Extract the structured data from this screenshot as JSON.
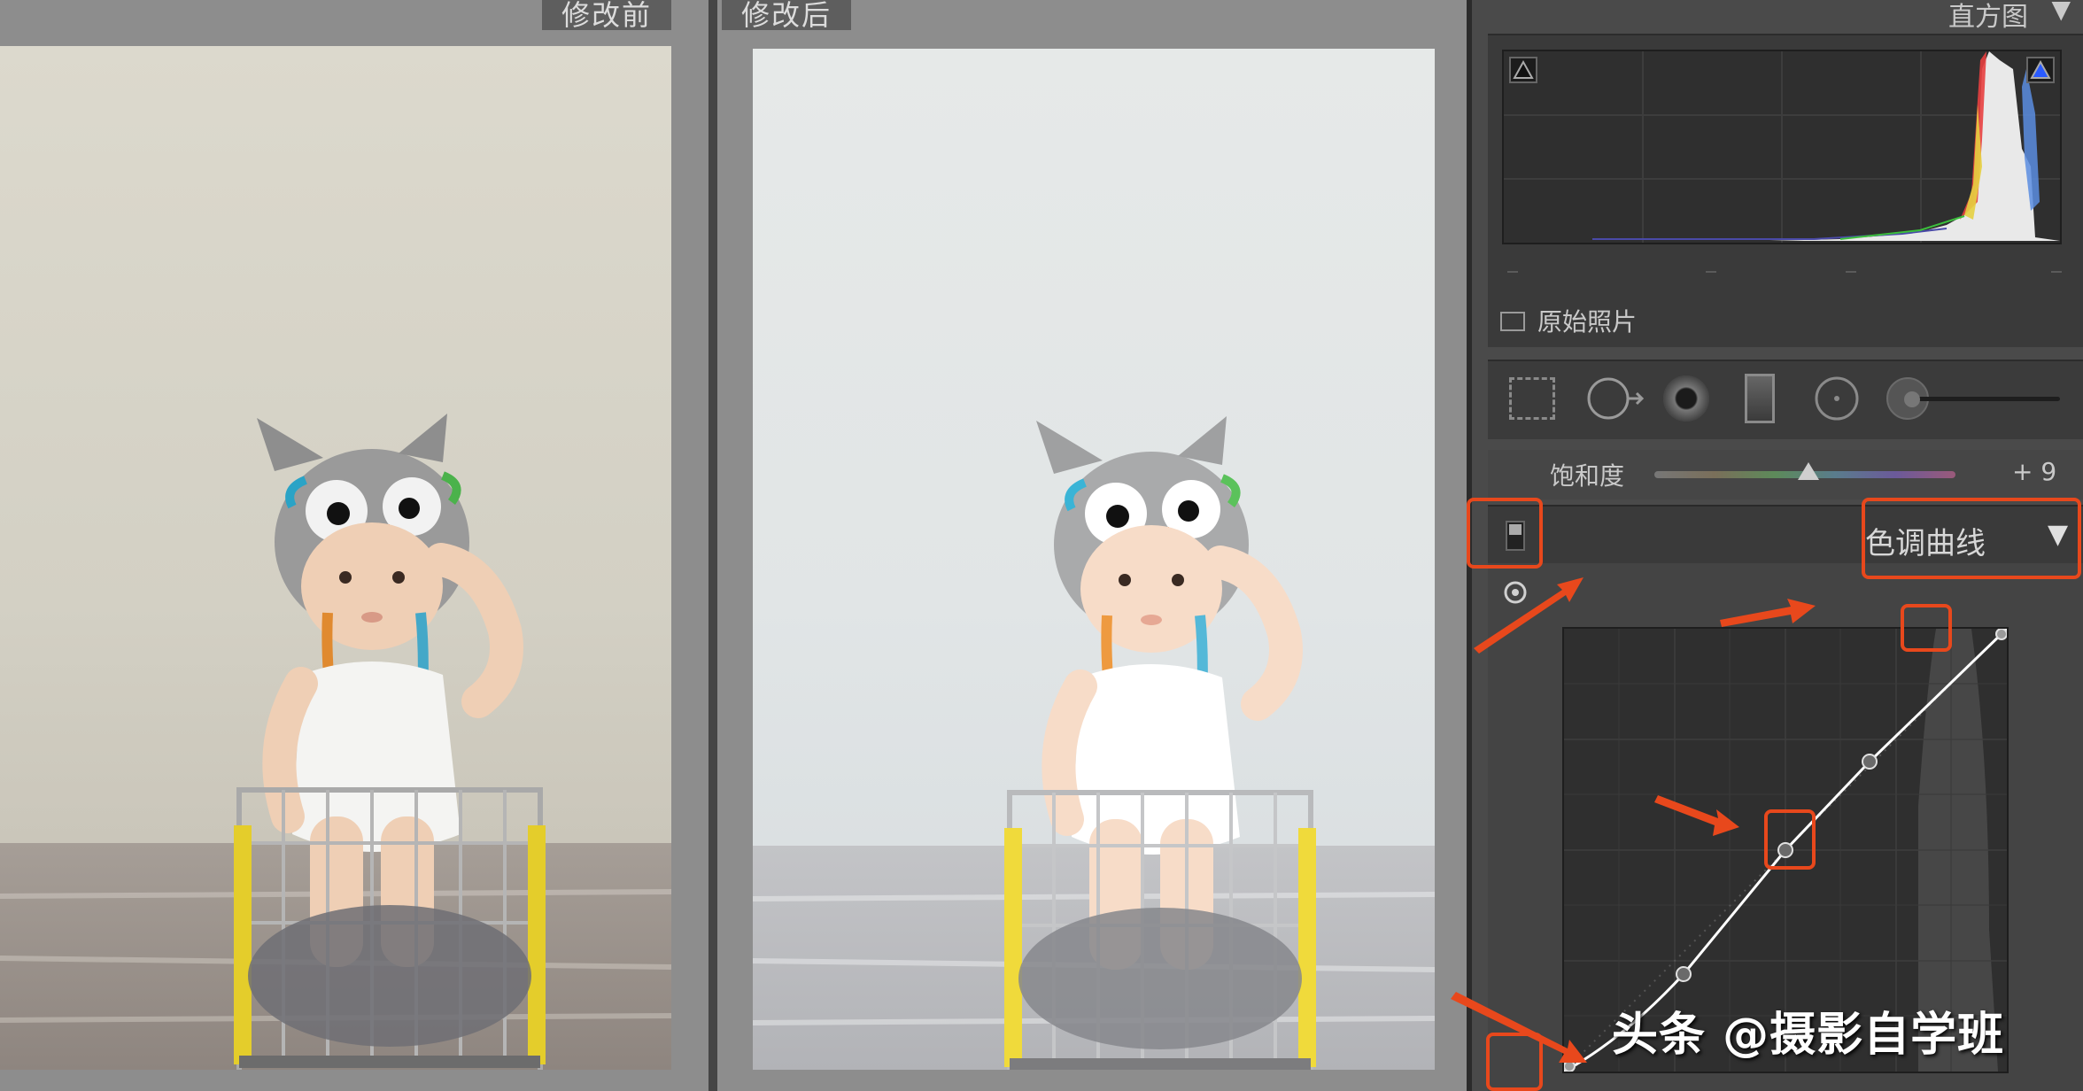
{
  "compare": {
    "before_label": "修改前",
    "after_label": "修改后"
  },
  "panel": {
    "histogram_title": "直方图",
    "histogram_arrow": "▼",
    "original_photo_label": "原始照片",
    "saturation_label": "饱和度",
    "saturation_value": "+ 9",
    "saturation_level": 0.54,
    "tone_curve_title": "色调曲线",
    "tone_curve_arrow": "▼"
  },
  "tone_curve_points": [
    [
      0,
      0
    ],
    [
      0.27,
      0.22
    ],
    [
      0.5,
      0.5
    ],
    [
      0.69,
      0.7
    ],
    [
      1,
      1
    ]
  ],
  "watermark": "头条 @摄影自学班",
  "colors": {
    "highlight": "#e8481c",
    "panel": "#4a4a4a",
    "curve": "#ffffff"
  },
  "icons": [
    "crop-overlay-icon",
    "spot-removal-icon",
    "red-eye-icon",
    "graduated-filter-icon",
    "radial-filter-icon",
    "adjustment-brush-icon",
    "target-adjust-icon",
    "clipping-shadow-icon",
    "clipping-highlight-icon",
    "dropdown-triangle-icon"
  ]
}
